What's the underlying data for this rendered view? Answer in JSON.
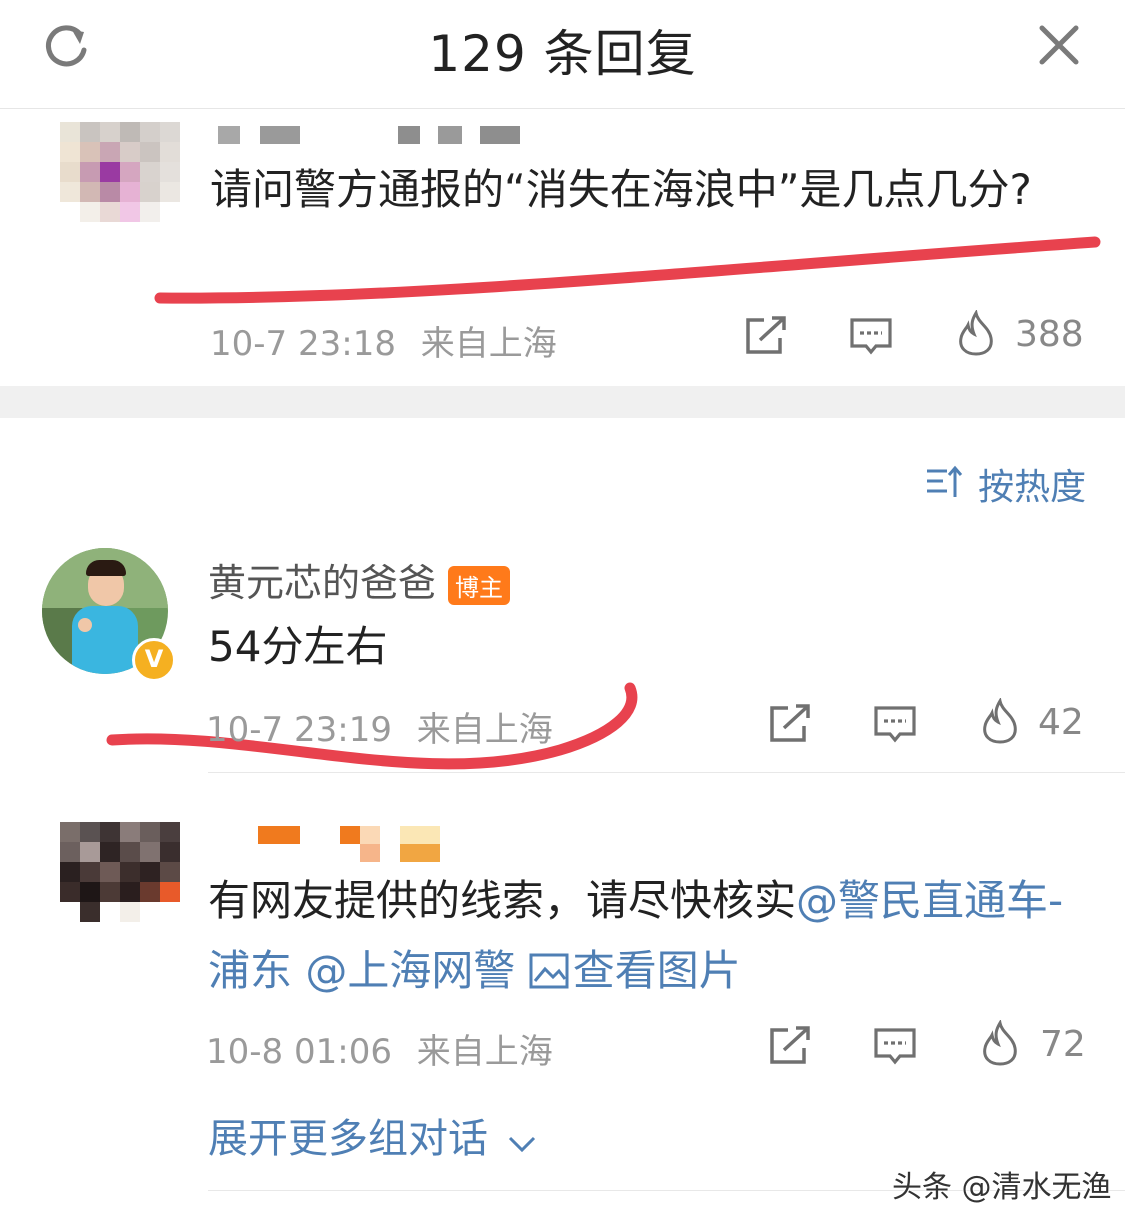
{
  "header": {
    "title": "129 条回复",
    "refresh_icon": "refresh-icon",
    "close_icon": "close-icon"
  },
  "root_comment": {
    "text": "请问警方通报的“消失在海浪中”是几点几分?",
    "time": "10-7 23:18",
    "location": "来自上海",
    "likes": "388"
  },
  "sort": {
    "label": "按热度",
    "icon": "sort-icon"
  },
  "replies": [
    {
      "name": "黄元芯的爸爸",
      "badge": "博主",
      "verified": true,
      "text": "54分左右",
      "time": "10-7 23:19",
      "location": "来自上海",
      "likes": "42"
    },
    {
      "text_plain": "有网友提供的线索，请尽快核实",
      "mention_1": "@警民直通车-浦东",
      "mention_2": "@上海网警",
      "image_link": "查看图片",
      "time": "10-8 01:06",
      "location": "来自上海",
      "likes": "72"
    }
  ],
  "expand_label": "展开更多组对话",
  "watermark": "头条 @清水无渔",
  "colors": {
    "link": "#4f7fb4",
    "badge": "#ff7a1a",
    "annotation": "#e8424e",
    "verified": "#f5b021"
  }
}
